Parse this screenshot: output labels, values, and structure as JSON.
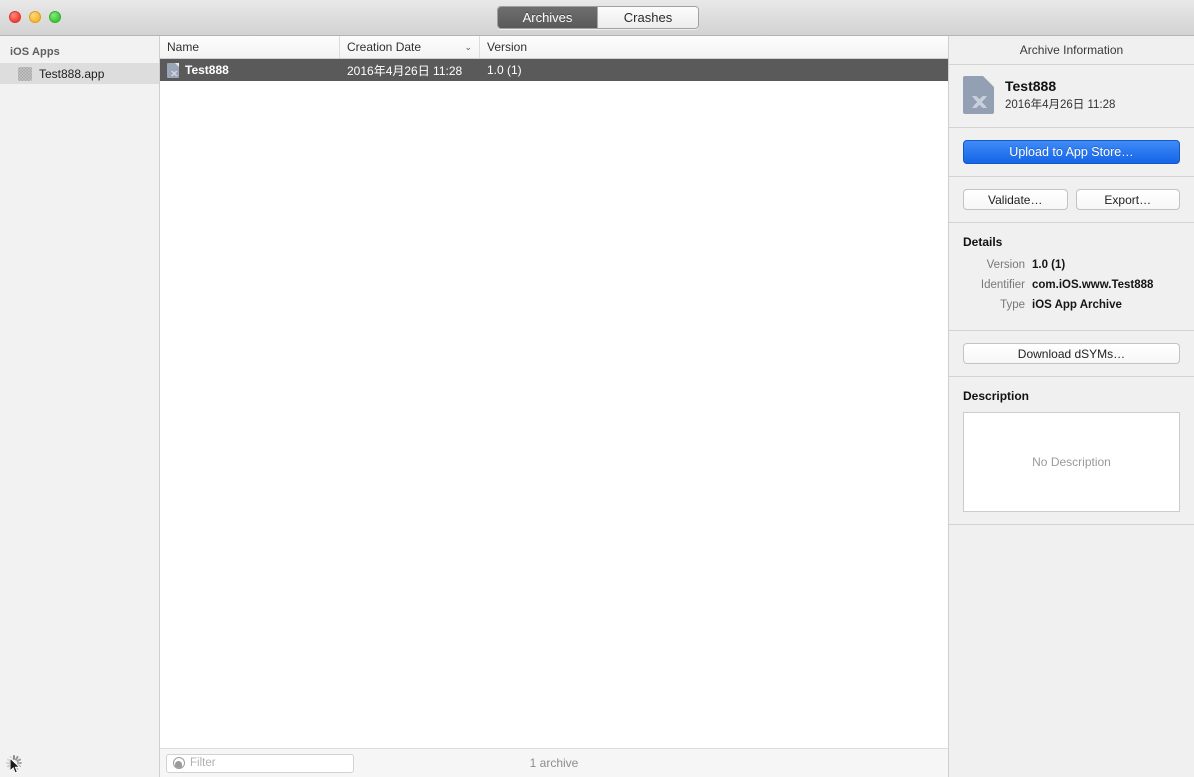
{
  "titlebar": {
    "tabs": [
      {
        "label": "Archives",
        "active": true
      },
      {
        "label": "Crashes",
        "active": false
      }
    ]
  },
  "sidebar": {
    "group_title": "iOS Apps",
    "items": [
      {
        "label": "Test888.app",
        "icon": "app-grid-icon",
        "selected": true
      }
    ]
  },
  "table": {
    "columns": [
      {
        "key": "name",
        "label": "Name"
      },
      {
        "key": "created",
        "label": "Creation Date",
        "sorted": true,
        "sort_glyph": "⌄"
      },
      {
        "key": "version",
        "label": "Version"
      }
    ],
    "rows": [
      {
        "name": "Test888",
        "created": "2016年4月26日 11:28",
        "version": "1.0 (1)",
        "selected": true,
        "icon": "archive-document-icon"
      }
    ],
    "footer": {
      "filter_placeholder": "Filter",
      "filter_value": "",
      "status": "1 archive"
    }
  },
  "inspector": {
    "header": "Archive Information",
    "summary": {
      "title": "Test888",
      "date": "2016年4月26日 11:28",
      "icon": "archive-document-icon"
    },
    "upload_button": "Upload to App Store…",
    "validate_button": "Validate…",
    "export_button": "Export…",
    "details": {
      "title": "Details",
      "rows": [
        {
          "label": "Version",
          "value": "1.0 (1)"
        },
        {
          "label": "Identifier",
          "value": "com.iOS.www.Test888"
        },
        {
          "label": "Type",
          "value": "iOS App Archive"
        }
      ]
    },
    "download_dsyms_button": "Download dSYMs…",
    "description": {
      "title": "Description",
      "empty_text": "No Description"
    }
  },
  "colors": {
    "accent_blue": "#1565e8",
    "selection_gray": "#5a5a5a",
    "panel_bg": "#f0f0f0",
    "sidebar_bg": "#f2f2f2"
  }
}
